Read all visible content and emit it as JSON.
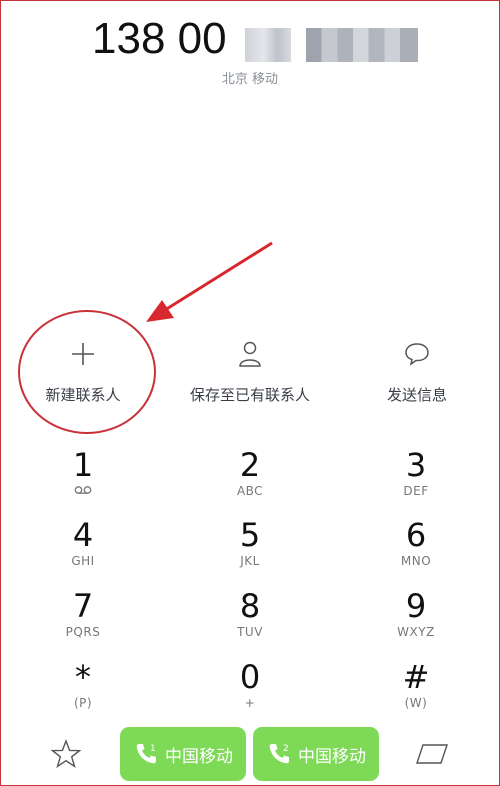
{
  "phone": {
    "number_prefix": "138 00",
    "carrier_location": "北京 移动"
  },
  "actions": {
    "new_contact": "新建联系人",
    "save_to_existing": "保存至已有联系人",
    "send_message": "发送信息"
  },
  "keypad": [
    {
      "digit": "1",
      "sub": ""
    },
    {
      "digit": "2",
      "sub": "ABC"
    },
    {
      "digit": "3",
      "sub": "DEF"
    },
    {
      "digit": "4",
      "sub": "GHI"
    },
    {
      "digit": "5",
      "sub": "JKL"
    },
    {
      "digit": "6",
      "sub": "MNO"
    },
    {
      "digit": "7",
      "sub": "PQRS"
    },
    {
      "digit": "8",
      "sub": "TUV"
    },
    {
      "digit": "9",
      "sub": "WXYZ"
    },
    {
      "digit": "*",
      "sub": "(P)"
    },
    {
      "digit": "0",
      "sub": "+"
    },
    {
      "digit": "#",
      "sub": "(W)"
    }
  ],
  "call_buttons": [
    {
      "sim": "1",
      "label": "中国移动"
    },
    {
      "sim": "2",
      "label": "中国移动"
    }
  ],
  "colors": {
    "call_green": "#7ed957",
    "annotation_red": "#c8323a"
  }
}
